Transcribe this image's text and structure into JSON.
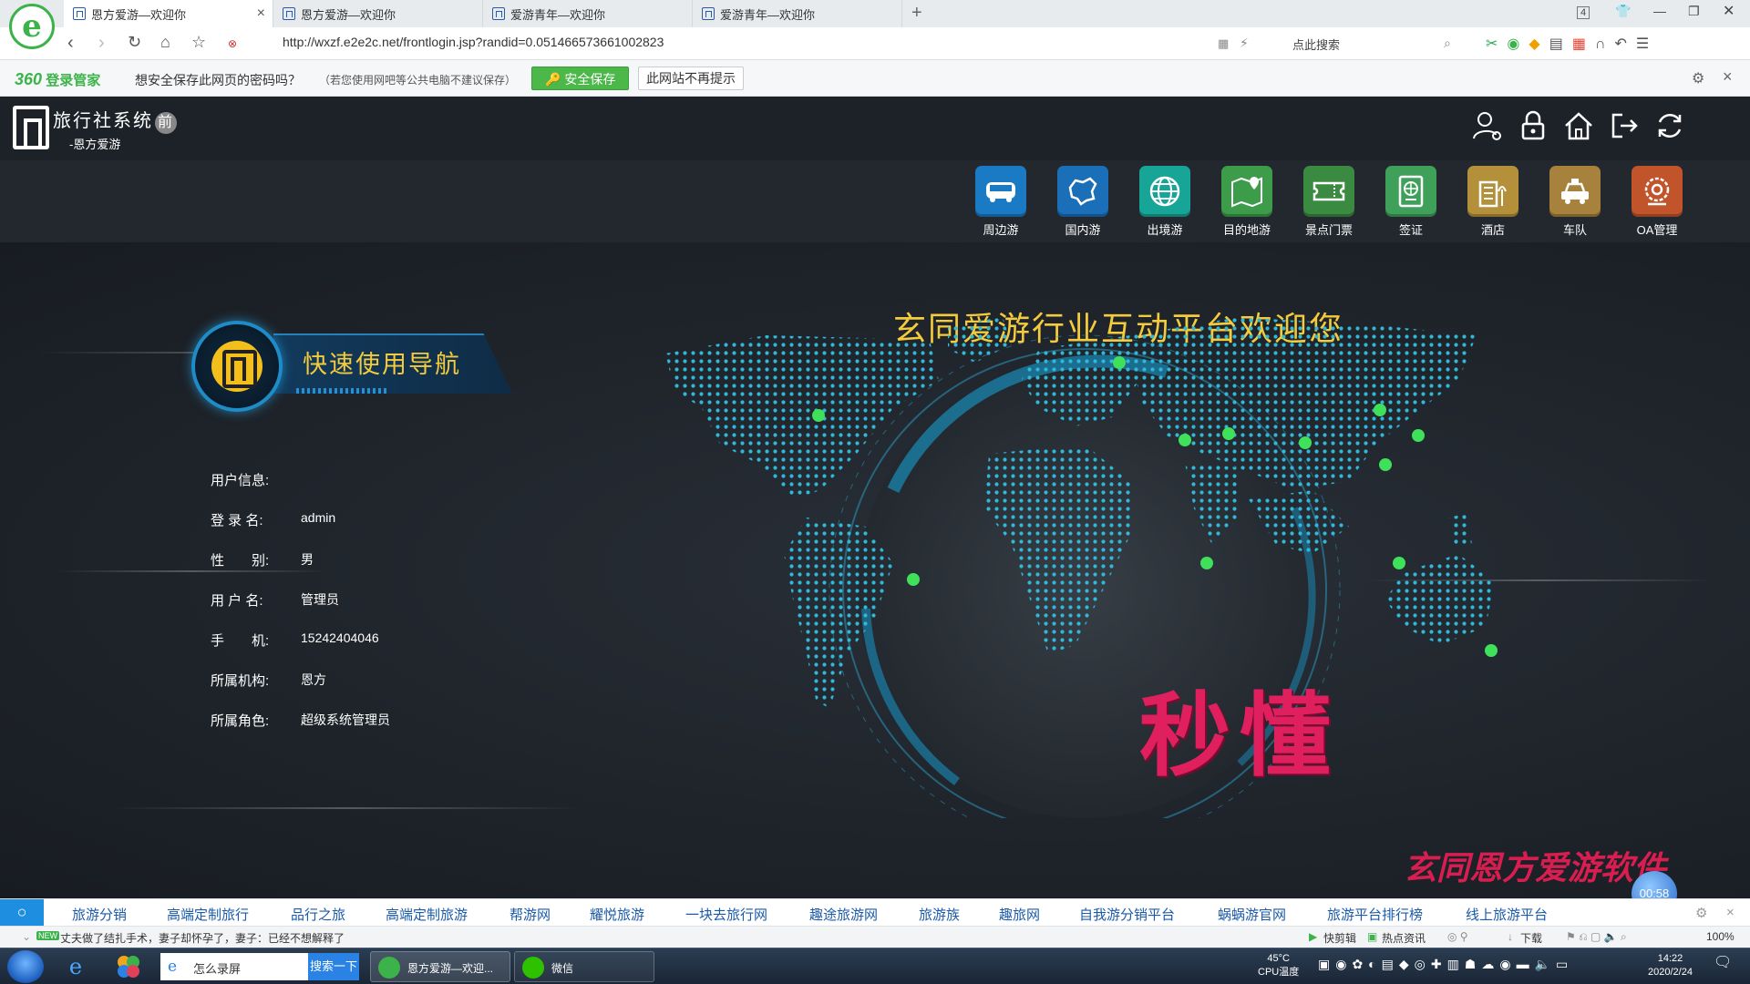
{
  "browser": {
    "tabs": [
      {
        "label": "恩方爱游—欢迎你",
        "active": true
      },
      {
        "label": "恩方爱游—欢迎你",
        "active": false
      },
      {
        "label": "爱游青年—欢迎你",
        "active": false
      },
      {
        "label": "爱游青年—欢迎你",
        "active": false
      }
    ],
    "tab_count": "4",
    "url": "http://wxzf.e2e2c.net/frontlogin.jsp?randid=0.051466573661002823",
    "search_placeholder": "点此搜索"
  },
  "password_bar": {
    "brand_num": "360",
    "brand_text": "登录管家",
    "prompt": "想安全保存此网页的密码吗？",
    "note": "（若您使用网吧等公共电脑不建议保存）",
    "save_label": "安全保存",
    "never_label": "此网站不再提示"
  },
  "app": {
    "title": "旅行社系统",
    "title_badge": "前",
    "subtitle": "-恩方爱游",
    "nav": [
      {
        "label": "周边游",
        "icon": "bus-icon",
        "color": "#1a7bc4"
      },
      {
        "label": "国内游",
        "icon": "china-map-icon",
        "color": "#1a6fb8"
      },
      {
        "label": "出境游",
        "icon": "globe-icon",
        "color": "#17a597"
      },
      {
        "label": "目的地游",
        "icon": "map-pin-icon",
        "color": "#3c9c4a"
      },
      {
        "label": "景点门票",
        "icon": "ticket-icon",
        "color": "#3b8a42"
      },
      {
        "label": "签证",
        "icon": "passport-icon",
        "color": "#3fa05a"
      },
      {
        "label": "酒店",
        "icon": "hotel-icon",
        "color": "#b4903a"
      },
      {
        "label": "车队",
        "icon": "taxi-icon",
        "color": "#a7823c"
      },
      {
        "label": "OA管理",
        "icon": "gears-icon",
        "color": "#c1542b"
      }
    ]
  },
  "main": {
    "welcome": "玄同爱游行业互动平台欢迎您",
    "quick_nav_title": "快速使用导航",
    "user_info": {
      "heading": "用户信息:",
      "rows": [
        {
          "label": "登 录 名:",
          "value": "admin"
        },
        {
          "label": "性　　别:",
          "value": "男"
        },
        {
          "label": "用 户 名:",
          "value": "管理员"
        },
        {
          "label": "手　　机:",
          "value": "15242404046"
        },
        {
          "label": "所属机构:",
          "value": "恩方"
        },
        {
          "label": "所属角色:",
          "value": "超级系统管理员"
        }
      ]
    },
    "watermark": "秒懂",
    "watermark_sub": "玄同恩方爱游软件",
    "timer": "00:58"
  },
  "links": [
    "旅游分销",
    "高端定制旅行",
    "品行之旅",
    "高端定制旅游",
    "帮游网",
    "耀悦旅游",
    "一块去旅行网",
    "趣途旅游网",
    "旅游族",
    "趣旅网",
    "自我游分销平台",
    "蜗蜗游官网",
    "旅游平台排行榜",
    "线上旅游平台"
  ],
  "statusbar": {
    "new_tag": "NEW",
    "news": "丈夫做了结扎手术，妻子却怀孕了，妻子：已经不想解释了",
    "items": [
      "快剪辑",
      "热点资讯",
      "下载"
    ],
    "zoom": "100%"
  },
  "taskbar": {
    "search_text": "怎么录屏",
    "search_btn": "搜索一下",
    "apps": [
      "恩方爱游—欢迎...",
      "微信"
    ],
    "cpu_temp": "45°C",
    "cpu_label": "CPU温度",
    "time": "14:22",
    "date": "2020/2/24"
  }
}
